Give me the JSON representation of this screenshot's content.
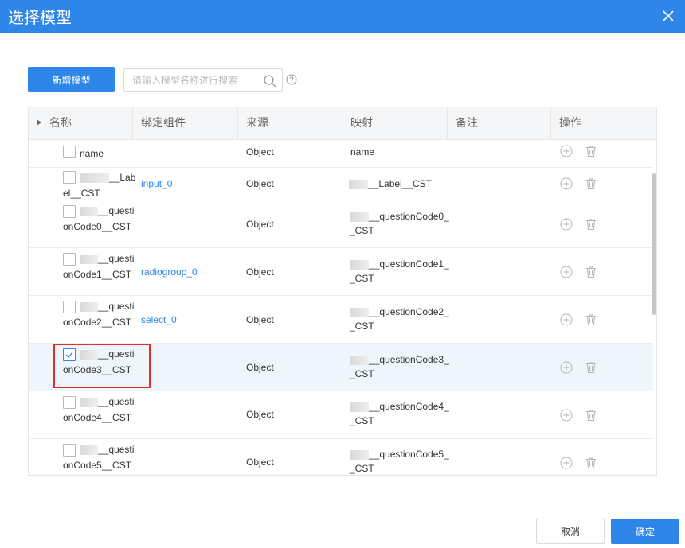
{
  "dialog": {
    "title": "选择模型",
    "close_icon": "close-icon"
  },
  "toolbar": {
    "add_label": "新增模型",
    "search_placeholder": "请输入模型名称进行搜索",
    "search_icon": "search-icon",
    "help_icon": "help-icon"
  },
  "table": {
    "columns": [
      "名称",
      "绑定组件",
      "来源",
      "映射",
      "备注",
      "操作"
    ],
    "rows": [
      {
        "name": "name",
        "binding": "",
        "source": "Object",
        "mapping": "name",
        "checked": false
      },
      {
        "name": "__Label__CST",
        "binding": "input_0",
        "source": "Object",
        "mapping": "__Label__CST",
        "checked": false
      },
      {
        "name": "__questionCode0__CST",
        "binding": "",
        "source": "Object",
        "mapping": "__questionCode0__CST",
        "checked": false
      },
      {
        "name": "__questionCode1__CST",
        "binding": "radiogroup_0",
        "source": "Object",
        "mapping": "__questionCode1__CST",
        "checked": false
      },
      {
        "name": "__questionCode2__CST",
        "binding": "select_0",
        "source": "Object",
        "mapping": "__questionCode2__CST",
        "checked": false
      },
      {
        "name": "__questionCode3__CST",
        "binding": "",
        "source": "Object",
        "mapping": "__questionCode3__CST",
        "checked": true
      },
      {
        "name": "__questionCode4__CST",
        "binding": "",
        "source": "Object",
        "mapping": "__questionCode4__CST",
        "checked": false
      },
      {
        "name": "__questionCode5__CST",
        "binding": "",
        "source": "Object",
        "mapping": "__questionCode5__CST",
        "checked": false
      }
    ]
  },
  "footer": {
    "cancel_label": "取消",
    "confirm_label": "确定"
  },
  "colors": {
    "primary": "#2e86e8",
    "highlight": "#e0302b",
    "link": "#2e86e8"
  }
}
